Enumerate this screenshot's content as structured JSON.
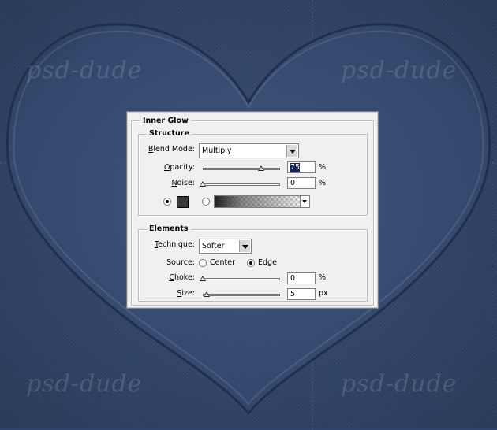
{
  "background": {
    "watermark": "psd-dude",
    "colors": {
      "denim": "#2f4468",
      "heart_fill": "#3a5176",
      "heart_edge": "#1f2f4d"
    }
  },
  "dialog": {
    "title": "Inner Glow",
    "structure": {
      "title": "Structure",
      "blend_mode": {
        "label": "Blend Mode:",
        "value": "Multiply",
        "icon": "chevron-down-icon"
      },
      "opacity": {
        "label": "Opacity:",
        "value": "75",
        "unit": "%",
        "slider_level": 0.75
      },
      "noise": {
        "label": "Noise:",
        "value": "0",
        "unit": "%",
        "slider_level": 0.0
      },
      "color_mode": {
        "selected": "solid-color",
        "swatch_color": "#3a3a3a"
      }
    },
    "elements": {
      "title": "Elements",
      "technique": {
        "label": "Technique:",
        "value": "Softer"
      },
      "source": {
        "label": "Source:",
        "options": [
          "Center",
          "Edge"
        ],
        "selected": "Edge"
      },
      "choke": {
        "label": "Choke:",
        "value": "0",
        "unit": "%",
        "slider_level": 0.0
      },
      "size": {
        "label": "Size:",
        "value": "5",
        "unit": "px",
        "slider_level": 0.04
      }
    }
  }
}
